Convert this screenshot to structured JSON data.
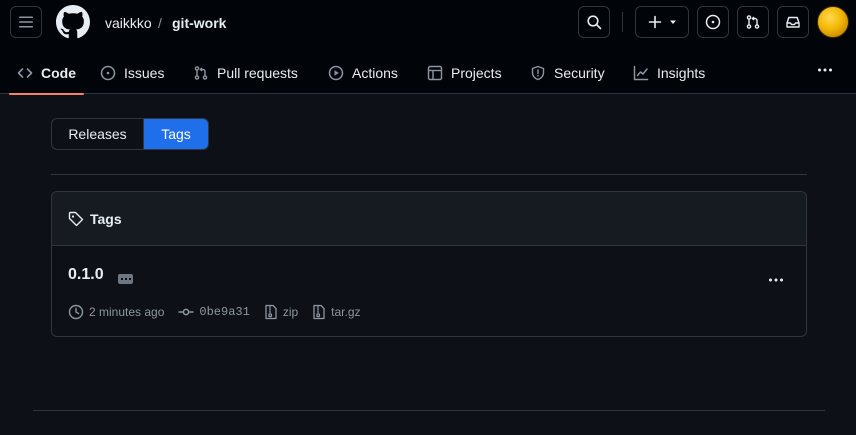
{
  "header": {
    "owner": "vaikkko",
    "separator": "/",
    "repo": "git-work"
  },
  "nav": {
    "tabs": [
      {
        "label": "Code",
        "icon": "code-icon",
        "active": true
      },
      {
        "label": "Issues",
        "icon": "issue-opened-icon"
      },
      {
        "label": "Pull requests",
        "icon": "git-pull-request-icon"
      },
      {
        "label": "Actions",
        "icon": "play-icon"
      },
      {
        "label": "Projects",
        "icon": "table-icon"
      },
      {
        "label": "Security",
        "icon": "shield-icon"
      },
      {
        "label": "Insights",
        "icon": "graph-icon"
      }
    ]
  },
  "toggle": {
    "releases_label": "Releases",
    "tags_label": "Tags",
    "selected": "Tags"
  },
  "tags_box": {
    "title": "Tags",
    "items": [
      {
        "name": "0.1.0",
        "time": "2 minutes ago",
        "commit": "0be9a31",
        "zip_label": "zip",
        "targz_label": "tar.gz"
      }
    ]
  },
  "colors": {
    "accent_blue": "#1f6feb",
    "active_underline": "#f78166",
    "background": "#0d1117"
  }
}
